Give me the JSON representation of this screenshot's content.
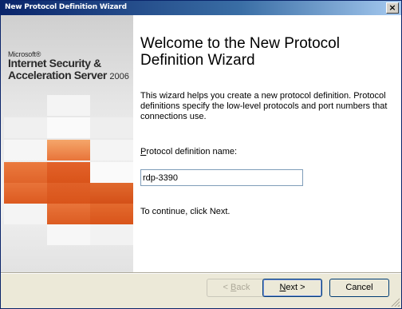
{
  "window": {
    "title": "New Protocol Definition Wizard",
    "close_glyph": "×"
  },
  "brand": {
    "company": "Microsoft®",
    "product_line1": "Internet Security &",
    "product_line2": "Acceleration Server",
    "product_year": "2006"
  },
  "content": {
    "heading": "Welcome to the New Protocol Definition Wizard",
    "description": "This wizard helps you create a new protocol definition. Protocol definitions specify the low-level protocols and port numbers that connections use.",
    "field_label_accel": "P",
    "field_label_rest": "rotocol definition name:",
    "field_value": "rdp-3390",
    "continue_text": "To continue, click Next."
  },
  "buttons": {
    "back_prefix": "< ",
    "back_accel": "B",
    "back_rest": "ack",
    "next_accel": "N",
    "next_rest": "ext >",
    "cancel": "Cancel"
  },
  "colors": {
    "orange_dark": "#d9541a",
    "orange_mid": "#e8743a",
    "orange_light": "#f29a5c",
    "tile_light": "#f7f7f7",
    "titlebar": "#0a246a"
  }
}
